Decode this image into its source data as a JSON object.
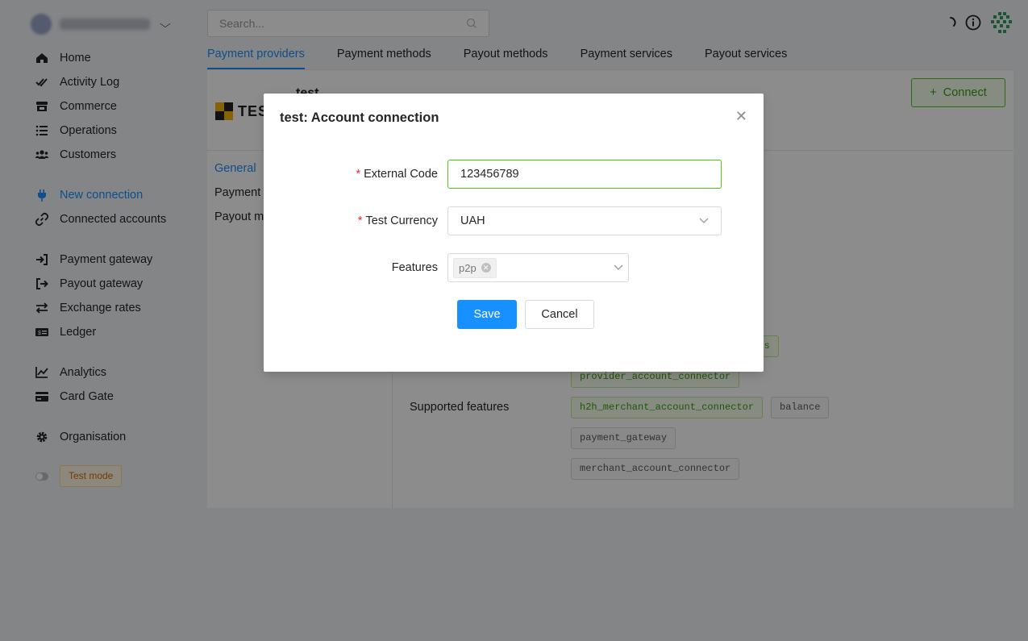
{
  "sidebar": {
    "nav_groups": [
      [
        {
          "label": "Home",
          "icon": "home-icon"
        },
        {
          "label": "Activity Log",
          "icon": "double-check-icon"
        },
        {
          "label": "Commerce",
          "icon": "store-icon"
        },
        {
          "label": "Operations",
          "icon": "list-icon"
        },
        {
          "label": "Customers",
          "icon": "users-icon"
        }
      ],
      [
        {
          "label": "New connection",
          "icon": "plug-icon",
          "active": true
        },
        {
          "label": "Connected accounts",
          "icon": "link-icon"
        }
      ],
      [
        {
          "label": "Payment gateway",
          "icon": "sign-in-icon"
        },
        {
          "label": "Payout gateway",
          "icon": "sign-out-icon"
        },
        {
          "label": "Exchange rates",
          "icon": "exchange-icon"
        },
        {
          "label": "Ledger",
          "icon": "money-bill-icon"
        }
      ],
      [
        {
          "label": "Analytics",
          "icon": "chart-line-icon"
        },
        {
          "label": "Card Gate",
          "icon": "credit-card-icon"
        }
      ],
      [
        {
          "label": "Organisation",
          "icon": "gear-icon"
        }
      ]
    ],
    "test_mode_label": "Test mode"
  },
  "header": {
    "search_placeholder": "Search..."
  },
  "tabs": [
    {
      "label": "Payment providers",
      "active": true
    },
    {
      "label": "Payment methods"
    },
    {
      "label": "Payout methods"
    },
    {
      "label": "Payment services"
    },
    {
      "label": "Payout services"
    }
  ],
  "provider": {
    "title": "test",
    "logo_text": "TES",
    "connect_label": "Connect",
    "side_menu": [
      "General",
      "Payment",
      "Payout m"
    ],
    "supported_features_label": "Supported features",
    "chips": [
      {
        "label": "ents",
        "style": "green"
      },
      {
        "label": "provider_account_connector",
        "style": "green"
      },
      {
        "label": "h2h_merchant_account_connector",
        "style": "green"
      },
      {
        "label": "balance",
        "style": "gray"
      },
      {
        "label": "payment_gateway",
        "style": "gray"
      },
      {
        "label": "merchant_account_connector",
        "style": "gray"
      }
    ]
  },
  "modal": {
    "title": "test: Account connection",
    "close_symbol": "✕",
    "external_code_label": "External Code",
    "external_code_value": "123456789",
    "test_currency_label": "Test Currency",
    "test_currency_value": "UAH",
    "features_label": "Features",
    "features_tags": [
      "p2p"
    ],
    "required_mark": "*",
    "save_label": "Save",
    "cancel_label": "Cancel"
  },
  "colors": {
    "primary": "#1890ff",
    "success": "#52c41a",
    "overlay": "rgba(0,0,0,0.45)"
  }
}
